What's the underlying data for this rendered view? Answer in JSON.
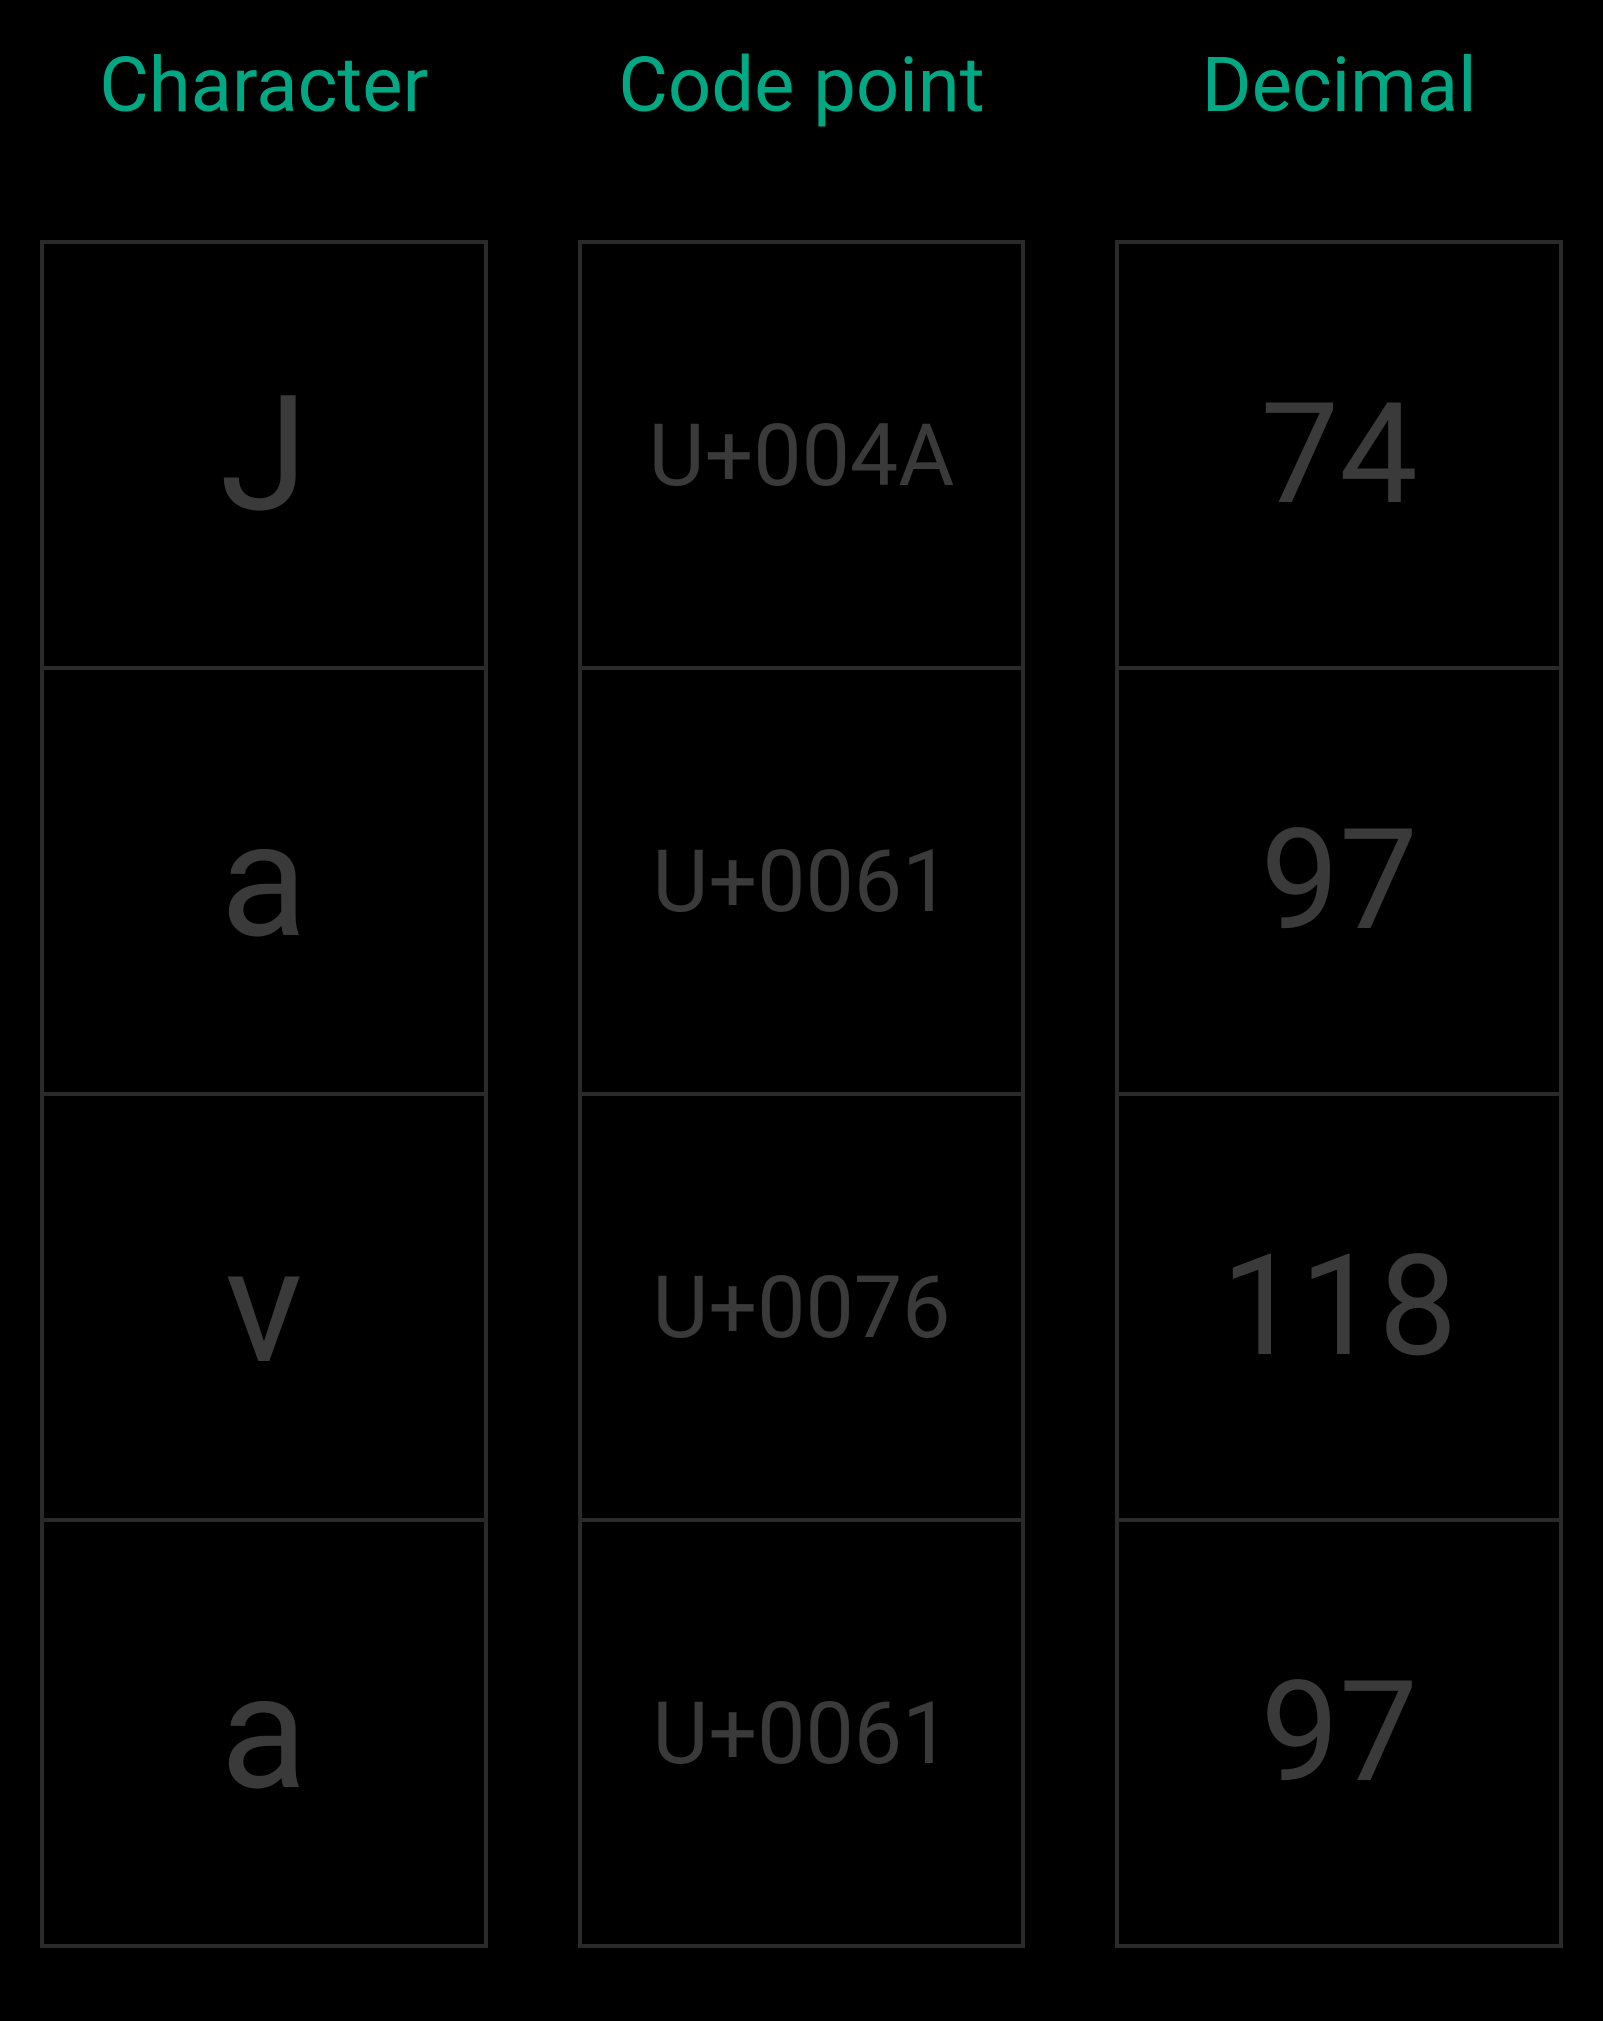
{
  "headers": {
    "character": "Character",
    "codepoint": "Code point",
    "decimal": "Decimal"
  },
  "rows": [
    {
      "character": "J",
      "codepoint": "U+004A",
      "decimal": "74"
    },
    {
      "character": "a",
      "codepoint": "U+0061",
      "decimal": "97"
    },
    {
      "character": "v",
      "codepoint": "U+0076",
      "decimal": "118"
    },
    {
      "character": "a",
      "codepoint": "U+0061",
      "decimal": "97"
    }
  ]
}
